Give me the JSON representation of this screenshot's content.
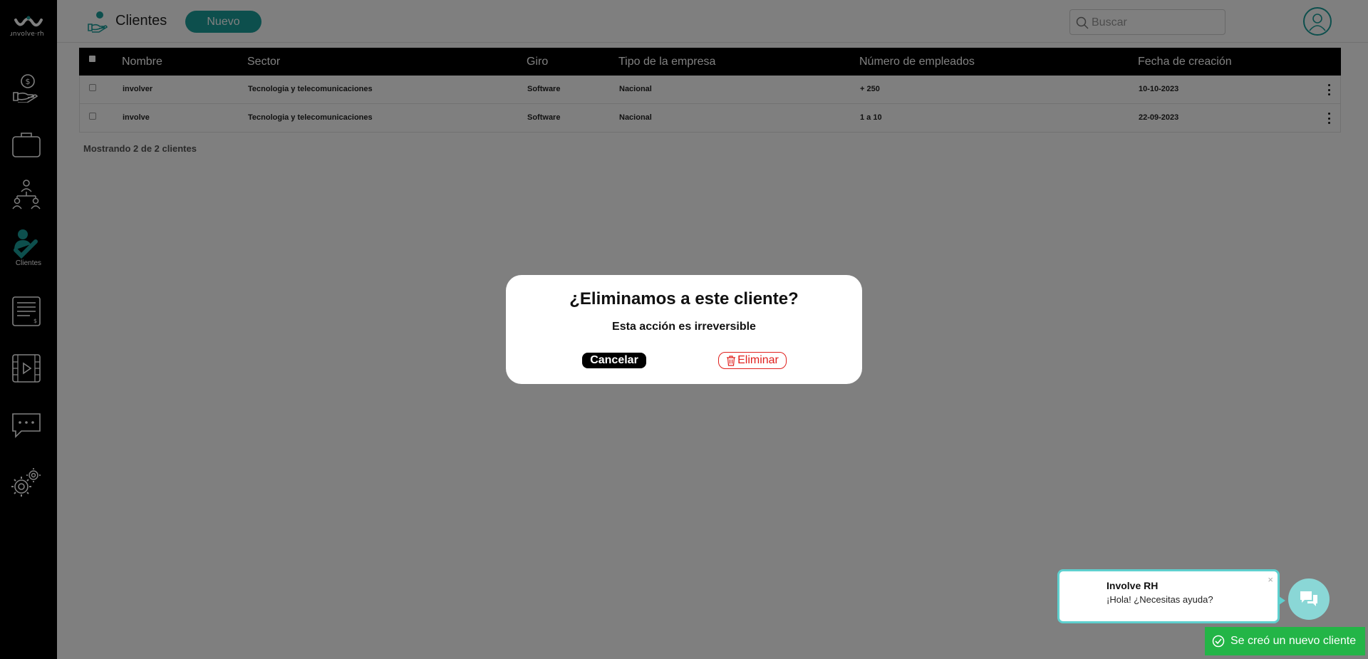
{
  "app": {
    "logo_text": "ɹnvolve·rh"
  },
  "sidebar": {
    "items": [
      {
        "icon": "money-hand-icon",
        "label": ""
      },
      {
        "icon": "briefcase-icon",
        "label": ""
      },
      {
        "icon": "org-chart-icon",
        "label": ""
      },
      {
        "icon": "clients-check-icon",
        "label": "Clientes"
      },
      {
        "icon": "invoice-icon",
        "label": ""
      },
      {
        "icon": "video-icon",
        "label": ""
      },
      {
        "icon": "chat-icon",
        "label": ""
      },
      {
        "icon": "settings-gears-icon",
        "label": ""
      }
    ]
  },
  "header": {
    "title": "Clientes",
    "new_label": "Nuevo",
    "search_placeholder": "Buscar"
  },
  "table": {
    "columns": [
      "Nombre",
      "Sector",
      "Giro",
      "Tipo de la empresa",
      "Número de empleados",
      "Fecha de creación"
    ],
    "rows": [
      {
        "nombre": "involver",
        "sector": "Tecnologia y telecomunicaciones",
        "giro": "Software",
        "tipo": "Nacional",
        "empleados": "+ 250",
        "fecha": "10-10-2023"
      },
      {
        "nombre": "involve",
        "sector": "Tecnologia y telecomunicaciones",
        "giro": "Software",
        "tipo": "Nacional",
        "empleados": "1 a 10",
        "fecha": "22-09-2023"
      }
    ],
    "footer": "Mostrando 2 de 2 clientes"
  },
  "modal": {
    "title": "¿Eliminamos a este cliente?",
    "subtitle": "Esta acción es irreversible",
    "cancel_label": "Cancelar",
    "delete_label": "Eliminar"
  },
  "chat": {
    "name": "Involve RH",
    "message": "¡Hola! ¿Necesitas ayuda?",
    "close": "×"
  },
  "toast": {
    "message": "Se creó un nuevo cliente"
  },
  "colors": {
    "accent": "#1a9e9a",
    "danger": "#e0201d",
    "success": "#23b547",
    "chat": "#5fd0cf"
  }
}
